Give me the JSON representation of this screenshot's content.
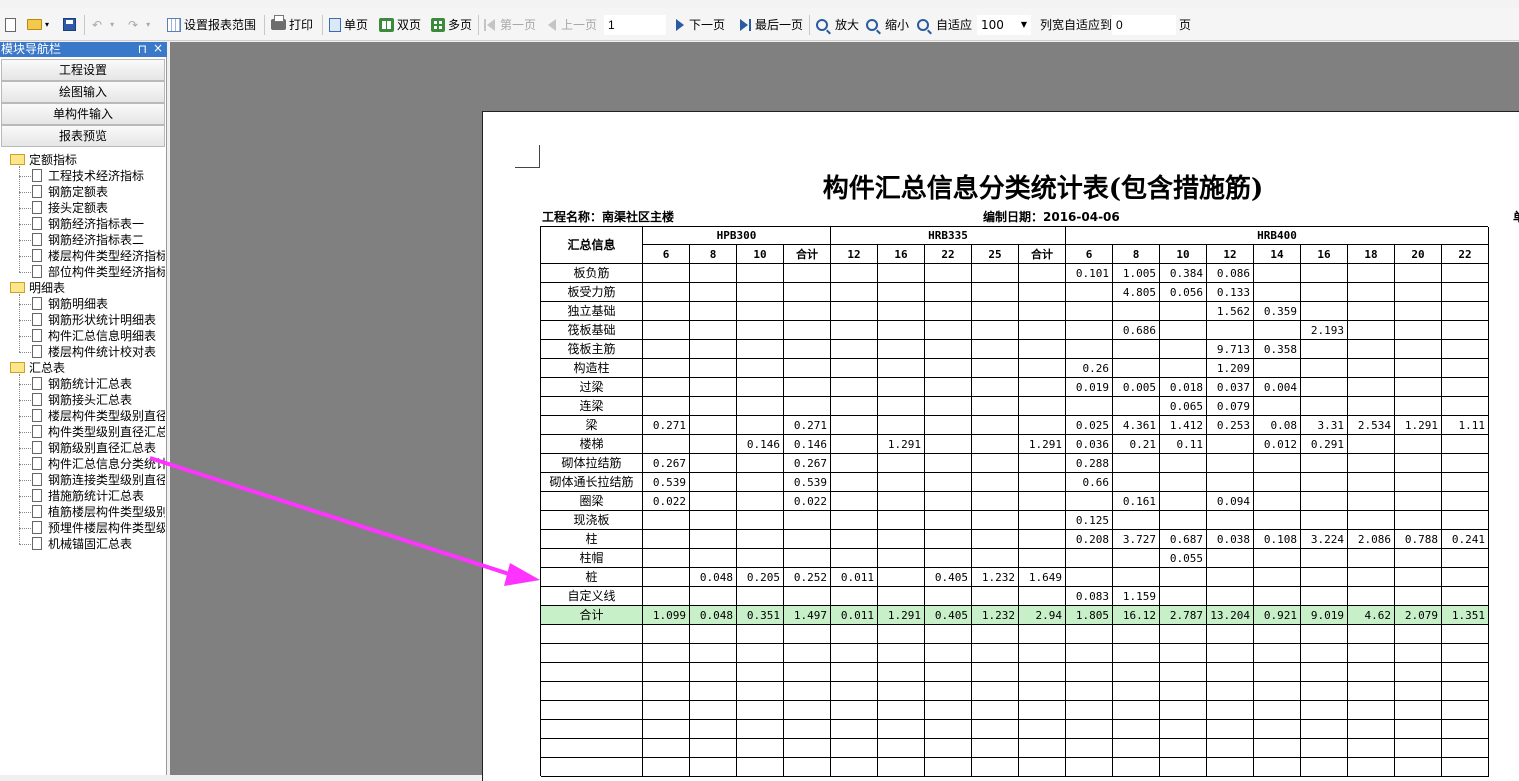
{
  "toolbar": {
    "set_range": "设置报表范围",
    "print": "打印",
    "single_page": "单页",
    "double_page": "双页",
    "multi_page": "多页",
    "first_page": "第一页",
    "prev_page": "上一页",
    "page_number": "1",
    "next_page": "下一页",
    "last_page": "最后一页",
    "zoom_in": "放大",
    "zoom_out": "缩小",
    "fit": "自适应",
    "zoom_value": "100",
    "column_fit_label": "列宽自适应到",
    "column_fit_value": "0",
    "page_suffix": "页"
  },
  "panel": {
    "title": "模块导航栏",
    "pin": "⊓",
    "close": "×",
    "modules": [
      "工程设置",
      "绘图输入",
      "单构件输入",
      "报表预览"
    ]
  },
  "tree": [
    {
      "type": "folder",
      "label": "定额指标"
    },
    {
      "type": "doc",
      "label": "工程技术经济指标"
    },
    {
      "type": "doc",
      "label": "钢筋定额表"
    },
    {
      "type": "doc",
      "label": "接头定额表"
    },
    {
      "type": "doc",
      "label": "钢筋经济指标表一"
    },
    {
      "type": "doc",
      "label": "钢筋经济指标表二"
    },
    {
      "type": "doc",
      "label": "楼层构件类型经济指标"
    },
    {
      "type": "doc",
      "label": "部位构件类型经济指标"
    },
    {
      "type": "folder",
      "label": "明细表"
    },
    {
      "type": "doc",
      "label": "钢筋明细表"
    },
    {
      "type": "doc",
      "label": "钢筋形状统计明细表"
    },
    {
      "type": "doc",
      "label": "构件汇总信息明细表"
    },
    {
      "type": "doc",
      "label": "楼层构件统计校对表"
    },
    {
      "type": "folder",
      "label": "汇总表"
    },
    {
      "type": "doc",
      "label": "钢筋统计汇总表"
    },
    {
      "type": "doc",
      "label": "钢筋接头汇总表"
    },
    {
      "type": "doc",
      "label": "楼层构件类型级别直径"
    },
    {
      "type": "doc",
      "label": "构件类型级别直径汇总"
    },
    {
      "type": "doc",
      "label": "钢筋级别直径汇总表"
    },
    {
      "type": "doc",
      "label": "构件汇总信息分类统计"
    },
    {
      "type": "doc",
      "label": "钢筋连接类型级别直径"
    },
    {
      "type": "doc",
      "label": "措施筋统计汇总表"
    },
    {
      "type": "doc",
      "label": "植筋楼层构件类型级别"
    },
    {
      "type": "doc",
      "label": "预埋件楼层构件类型级"
    },
    {
      "type": "doc",
      "label": "机械锚固汇总表"
    }
  ],
  "report": {
    "title": "构件汇总信息分类统计表(包含措施筋)",
    "project_label": "工程名称：南渠社区主楼",
    "date_label": "编制日期：2016-04-06",
    "unit_label": "单位",
    "corner_header": "汇总信息",
    "groups": [
      {
        "name": "HPB300",
        "cols": [
          "6",
          "8",
          "10",
          "合计"
        ]
      },
      {
        "name": "HRB335",
        "cols": [
          "12",
          "16",
          "22",
          "25",
          "合计"
        ]
      },
      {
        "name": "HRB400",
        "cols": [
          "6",
          "8",
          "10",
          "12",
          "14",
          "16",
          "18",
          "20",
          "22"
        ]
      }
    ],
    "rows": [
      {
        "label": "板负筋",
        "values": [
          "",
          "",
          "",
          "",
          "",
          "",
          "",
          "",
          "",
          "0.101",
          "1.005",
          "0.384",
          "0.086",
          "",
          "",
          "",
          "",
          ""
        ]
      },
      {
        "label": "板受力筋",
        "values": [
          "",
          "",
          "",
          "",
          "",
          "",
          "",
          "",
          "",
          "",
          "4.805",
          "0.056",
          "0.133",
          "",
          "",
          "",
          "",
          ""
        ]
      },
      {
        "label": "独立基础",
        "values": [
          "",
          "",
          "",
          "",
          "",
          "",
          "",
          "",
          "",
          "",
          "",
          "",
          "1.562",
          "0.359",
          "",
          "",
          "",
          ""
        ]
      },
      {
        "label": "筏板基础",
        "values": [
          "",
          "",
          "",
          "",
          "",
          "",
          "",
          "",
          "",
          "",
          "0.686",
          "",
          "",
          "",
          "2.193",
          "",
          "",
          ""
        ]
      },
      {
        "label": "筏板主筋",
        "values": [
          "",
          "",
          "",
          "",
          "",
          "",
          "",
          "",
          "",
          "",
          "",
          "",
          "9.713",
          "0.358",
          "",
          "",
          "",
          ""
        ]
      },
      {
        "label": "构造柱",
        "values": [
          "",
          "",
          "",
          "",
          "",
          "",
          "",
          "",
          "",
          "0.26",
          "",
          "",
          "1.209",
          "",
          "",
          "",
          "",
          ""
        ]
      },
      {
        "label": "过梁",
        "values": [
          "",
          "",
          "",
          "",
          "",
          "",
          "",
          "",
          "",
          "0.019",
          "0.005",
          "0.018",
          "0.037",
          "0.004",
          "",
          "",
          "",
          ""
        ]
      },
      {
        "label": "连梁",
        "values": [
          "",
          "",
          "",
          "",
          "",
          "",
          "",
          "",
          "",
          "",
          "",
          "0.065",
          "0.079",
          "",
          "",
          "",
          "",
          ""
        ]
      },
      {
        "label": "梁",
        "values": [
          "0.271",
          "",
          "",
          "0.271",
          "",
          "",
          "",
          "",
          "",
          "0.025",
          "4.361",
          "1.412",
          "0.253",
          "0.08",
          "3.31",
          "2.534",
          "1.291",
          "1.11"
        ]
      },
      {
        "label": "楼梯",
        "values": [
          "",
          "",
          "0.146",
          "0.146",
          "",
          "1.291",
          "",
          "",
          "1.291",
          "0.036",
          "0.21",
          "0.11",
          "",
          "0.012",
          "0.291",
          "",
          "",
          ""
        ]
      },
      {
        "label": "砌体拉结筋",
        "values": [
          "0.267",
          "",
          "",
          "0.267",
          "",
          "",
          "",
          "",
          "",
          "0.288",
          "",
          "",
          "",
          "",
          "",
          "",
          "",
          ""
        ]
      },
      {
        "label": "砌体通长拉结筋",
        "values": [
          "0.539",
          "",
          "",
          "0.539",
          "",
          "",
          "",
          "",
          "",
          "0.66",
          "",
          "",
          "",
          "",
          "",
          "",
          "",
          ""
        ]
      },
      {
        "label": "圈梁",
        "values": [
          "0.022",
          "",
          "",
          "0.022",
          "",
          "",
          "",
          "",
          "",
          "",
          "0.161",
          "",
          "0.094",
          "",
          "",
          "",
          "",
          ""
        ]
      },
      {
        "label": "现浇板",
        "values": [
          "",
          "",
          "",
          "",
          "",
          "",
          "",
          "",
          "",
          "0.125",
          "",
          "",
          "",
          "",
          "",
          "",
          "",
          ""
        ]
      },
      {
        "label": "柱",
        "values": [
          "",
          "",
          "",
          "",
          "",
          "",
          "",
          "",
          "",
          "0.208",
          "3.727",
          "0.687",
          "0.038",
          "0.108",
          "3.224",
          "2.086",
          "0.788",
          "0.241"
        ]
      },
      {
        "label": "柱帽",
        "values": [
          "",
          "",
          "",
          "",
          "",
          "",
          "",
          "",
          "",
          "",
          "",
          "0.055",
          "",
          "",
          "",
          "",
          "",
          ""
        ]
      },
      {
        "label": "桩",
        "values": [
          "",
          "0.048",
          "0.205",
          "0.252",
          "0.011",
          "",
          "0.405",
          "1.232",
          "1.649",
          "",
          "",
          "",
          "",
          "",
          "",
          "",
          "",
          ""
        ]
      },
      {
        "label": "自定义线",
        "values": [
          "",
          "",
          "",
          "",
          "",
          "",
          "",
          "",
          "",
          "0.083",
          "1.159",
          "",
          "",
          "",
          "",
          "",
          "",
          ""
        ]
      },
      {
        "label": "合计",
        "total": true,
        "values": [
          "1.099",
          "0.048",
          "0.351",
          "1.497",
          "0.011",
          "1.291",
          "0.405",
          "1.232",
          "2.94",
          "1.805",
          "16.12",
          "2.787",
          "13.204",
          "0.921",
          "9.019",
          "4.62",
          "2.079",
          "1.351"
        ]
      }
    ],
    "empty_rows": 8
  },
  "colors": {
    "panel_header": "#3a78c9",
    "viewer_bg": "#808080",
    "total_row": "#c8f0c8",
    "annotation_arrow": "#ff33ff"
  }
}
